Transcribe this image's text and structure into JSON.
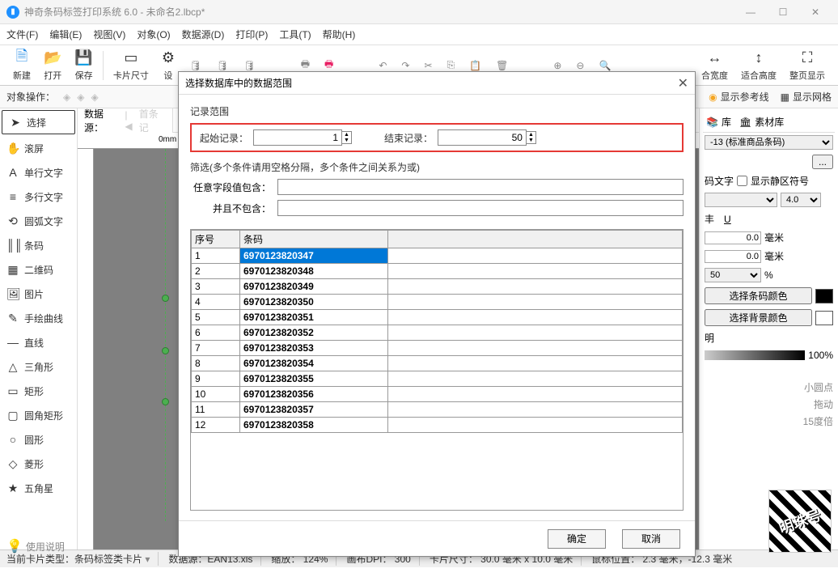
{
  "window": {
    "title": "神奇条码标签打印系统 6.0 - 未命名2.lbcp*"
  },
  "menu": [
    "文件(F)",
    "编辑(E)",
    "视图(V)",
    "对象(O)",
    "数据源(D)",
    "打印(P)",
    "工具(T)",
    "帮助(H)"
  ],
  "toolbar": {
    "new": "新建",
    "open": "打开",
    "save": "保存",
    "cardsize": "卡片尺寸",
    "set": "设",
    "fitw": "合宽度",
    "fith": "适合高度",
    "full": "整页显示"
  },
  "opsbar": {
    "label": "对象操作：",
    "showref": "显示参考线",
    "showgrid": "显示网格"
  },
  "lefttools": {
    "select": "选择",
    "pan": "滚屏",
    "text1": "单行文字",
    "text2": "多行文字",
    "arctext": "圆弧文字",
    "barcode": "条码",
    "qrcode": "二维码",
    "image": "图片",
    "freehand": "手绘曲线",
    "line": "直线",
    "triangle": "三角形",
    "rect": "矩形",
    "roundrect": "圆角矩形",
    "circle": "圆形",
    "diamond": "菱形",
    "star": "五角星"
  },
  "dsbar": {
    "label": "数据源：",
    "first": "首条记"
  },
  "rightpanel": {
    "lib": "库",
    "matlib": "素材库",
    "bctype": "-13 (标准商品条码)",
    "more": "...",
    "showtext": "码文字",
    "showquiet": "显示静区符号",
    "fontsize": "4.0",
    "u": "丰",
    "uu": "U",
    "h1": "0.0",
    "u1": "毫米",
    "h2": "0.0",
    "u2": "毫米",
    "pct": "50",
    "pctu": "%",
    "selbc": "选择条码颜色",
    "selbg": "选择背景颜色",
    "trans": "明",
    "opacity": "100%",
    "hint1": "小圆点",
    "hint2": "拖动",
    "hint3": "15度倍"
  },
  "status": {
    "cardtype": "当前卡片类型：条码标签类卡片",
    "ds": "数据源：EAN13.xls",
    "zoom": "缩放： 124%",
    "dpi": "画布DPI： 300",
    "size": "卡片尺寸： 30.0 毫米 x 10.0 毫米",
    "mouse": "鼠标位置： 2.3 毫米，-12.3 毫米"
  },
  "help": "使用说明",
  "dialog": {
    "title": "选择数据库中的数据范围",
    "range_label": "记录范围",
    "start_label": "起始记录：",
    "start": "1",
    "end_label": "结束记录：",
    "end": "50",
    "filter_label": "筛选(多个条件请用空格分隔，多个条件之间关系为或)",
    "any_label": "任意字段值包含：",
    "excl_label": "并且不包含：",
    "col_idx": "序号",
    "col_bc": "条码",
    "ok": "确定",
    "cancel": "取消",
    "rows": [
      {
        "i": "1",
        "v": "6970123820347"
      },
      {
        "i": "2",
        "v": "6970123820348"
      },
      {
        "i": "3",
        "v": "6970123820349"
      },
      {
        "i": "4",
        "v": "6970123820350"
      },
      {
        "i": "5",
        "v": "6970123820351"
      },
      {
        "i": "6",
        "v": "6970123820352"
      },
      {
        "i": "7",
        "v": "6970123820353"
      },
      {
        "i": "8",
        "v": "6970123820354"
      },
      {
        "i": "9",
        "v": "6970123820355"
      },
      {
        "i": "10",
        "v": "6970123820356"
      },
      {
        "i": "11",
        "v": "6970123820357"
      },
      {
        "i": "12",
        "v": "6970123820358"
      }
    ]
  },
  "chart_data": {
    "type": "table",
    "columns": [
      "序号",
      "条码"
    ],
    "rows": [
      [
        "1",
        "6970123820347"
      ],
      [
        "2",
        "6970123820348"
      ],
      [
        "3",
        "6970123820349"
      ],
      [
        "4",
        "6970123820350"
      ],
      [
        "5",
        "6970123820351"
      ],
      [
        "6",
        "6970123820352"
      ],
      [
        "7",
        "6970123820353"
      ],
      [
        "8",
        "6970123820354"
      ],
      [
        "9",
        "6970123820355"
      ],
      [
        "10",
        "6970123820356"
      ],
      [
        "11",
        "6970123820357"
      ],
      [
        "12",
        "6970123820358"
      ]
    ]
  }
}
